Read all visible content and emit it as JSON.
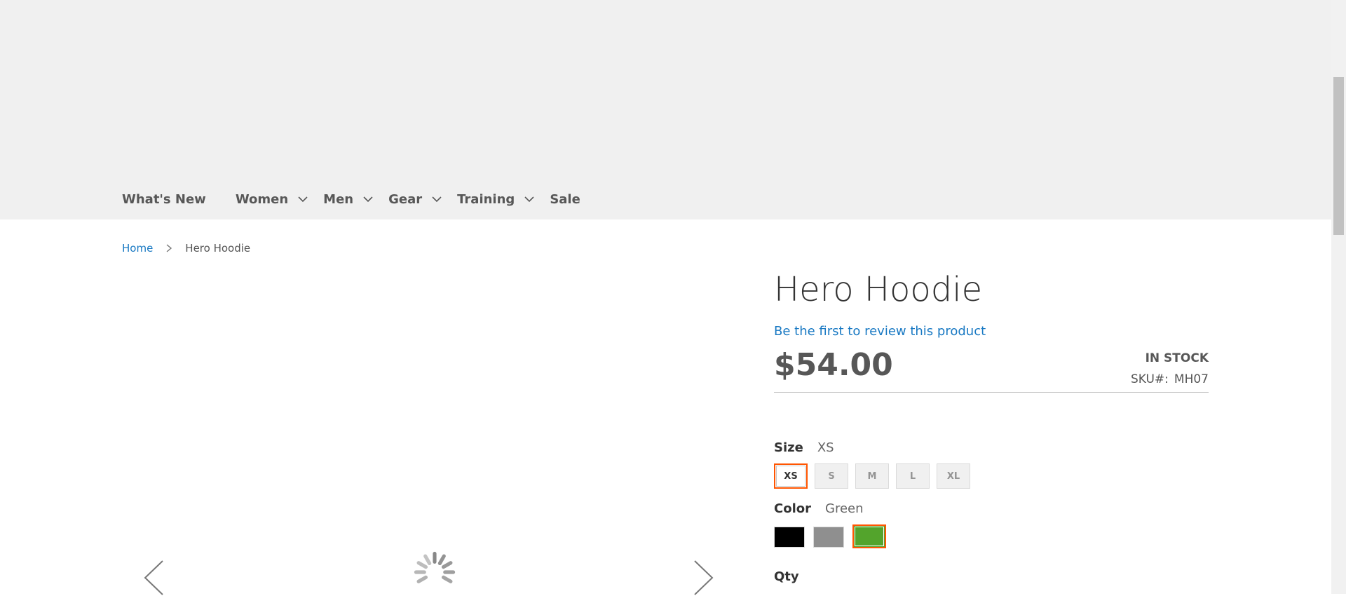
{
  "nav": {
    "items": [
      {
        "label": "What's New",
        "has_submenu": false
      },
      {
        "label": "Women",
        "has_submenu": true
      },
      {
        "label": "Men",
        "has_submenu": true
      },
      {
        "label": "Gear",
        "has_submenu": true
      },
      {
        "label": "Training",
        "has_submenu": true
      },
      {
        "label": "Sale",
        "has_submenu": false
      }
    ]
  },
  "breadcrumb": {
    "home": "Home",
    "current": "Hero Hoodie"
  },
  "product": {
    "title": "Hero Hoodie",
    "review_link": "Be the first to review this product",
    "price": "$54.00",
    "stock": "IN STOCK",
    "sku_label": "SKU#:",
    "sku_value": "MH07"
  },
  "options": {
    "size": {
      "label": "Size",
      "selected": "XS",
      "values": [
        "XS",
        "S",
        "M",
        "L",
        "XL"
      ]
    },
    "color": {
      "label": "Color",
      "selected": "Green",
      "values": [
        {
          "name": "Black",
          "hex": "#000000"
        },
        {
          "name": "Gray",
          "hex": "#8f8f8f"
        },
        {
          "name": "Green",
          "hex": "#53a42c"
        }
      ]
    },
    "qty_label": "Qty"
  },
  "colors": {
    "link": "#1979c3",
    "accent_border": "#ff5501",
    "header_bg": "#f0f0f0"
  }
}
